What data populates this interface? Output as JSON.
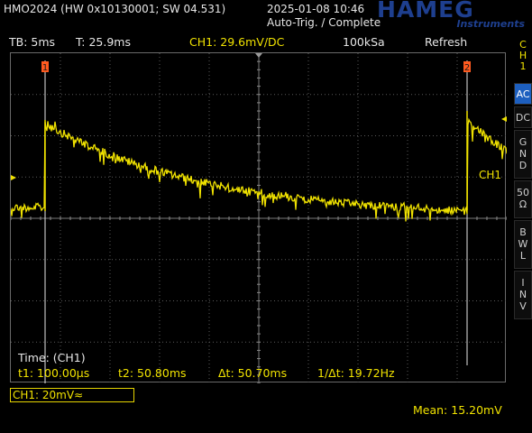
{
  "header": {
    "device": "HMO2024 (HW 0x10130001; SW 04.531)",
    "datetime": "2025-01-08 10:46",
    "trigger_status": "Auto-Trig. / Complete",
    "brand": "HAMEG",
    "brand_sub": "Instruments"
  },
  "infobar": {
    "timebase": "TB: 5ms",
    "trigger_time": "T: 25.9ms",
    "channel_setting": "CH1: 29.6mV/DC",
    "sample_rate": "100kSa",
    "mode": "Refresh"
  },
  "plot": {
    "grid_divisions": {
      "x": 10,
      "y": 8
    },
    "channel_marker": "CH1",
    "level_marker": "1",
    "cursor1_label": "1",
    "cursor2_label": "2",
    "trace_color": "#f0e200",
    "cursor_marker_color": "#ff5a1f",
    "grid_color": "#5a5a5a"
  },
  "side_menu": {
    "channel": "CH1",
    "buttons": [
      {
        "label": "AC",
        "active": true
      },
      {
        "label": "DC",
        "active": false
      },
      {
        "label": "GND",
        "active": false
      },
      {
        "label": "50Ω",
        "active": false
      },
      {
        "label": "BWL",
        "active": false
      },
      {
        "label": "INV",
        "active": false
      }
    ],
    "active_color": "#1d5fbf"
  },
  "measurements": {
    "title": "Time: (CH1)",
    "t1": "t1: 100.00µs",
    "t2": "t2: 50.80ms",
    "dt": "Δt: 50.70ms",
    "inv_dt": "1/Δt: 19.72Hz"
  },
  "footer": {
    "ch1_setting": "CH1: 20mV≈",
    "mean": "Mean: 15.20mV"
  }
}
